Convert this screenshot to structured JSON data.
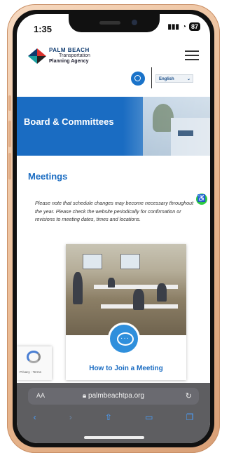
{
  "status": {
    "time": "1:35",
    "battery": "87"
  },
  "org": {
    "line1": "PALM BEACH",
    "line2": "Transportation",
    "line3": "Planning Agency"
  },
  "language": {
    "selected": "English"
  },
  "banner": {
    "title": "Board & Committees"
  },
  "main": {
    "heading": "Meetings",
    "note": "Please note that schedule changes may become necessary throughout the year.  Please check the website periodically for confirmation or revisions to meeting dates, times and locations.",
    "card_title": "How to Join a Meeting"
  },
  "recaptcha": {
    "text": "Privacy - Terms"
  },
  "browser": {
    "aa": "AA",
    "url": "palmbeachtpa.org"
  },
  "colors": {
    "brand_blue": "#1a6cc2",
    "accessibility_green": "#2ecc40",
    "logo_red": "#d9302c",
    "logo_teal": "#1a9fa0"
  },
  "icons": [
    "search-icon",
    "menu-icon",
    "chevron-down-icon",
    "accessibility-icon",
    "chat-icon",
    "recaptcha-icon",
    "lock-icon",
    "reload-icon",
    "back-icon",
    "forward-icon",
    "share-icon",
    "bookmarks-icon",
    "tabs-icon"
  ]
}
